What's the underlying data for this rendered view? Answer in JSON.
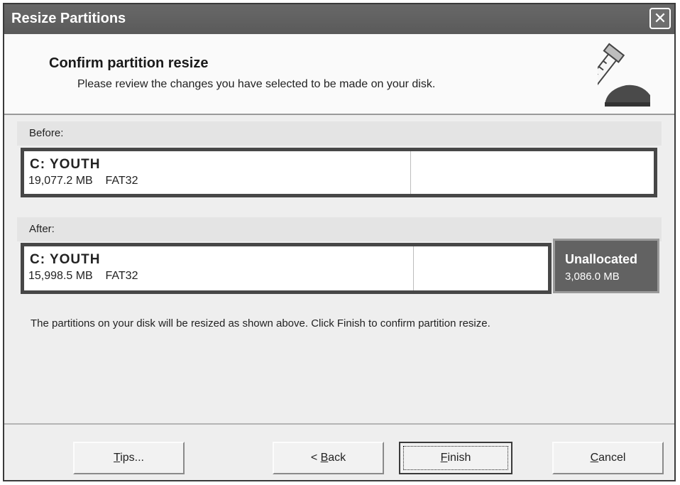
{
  "window": {
    "title": "Resize Partitions",
    "close_glyph": "✕"
  },
  "header": {
    "title": "Confirm partition resize",
    "subtitle": "Please review the changes you have selected to be made on your disk.",
    "icon": "ruler-disk-icon"
  },
  "before": {
    "label": "Before:",
    "partition": {
      "name": "C:  YOUTH",
      "size": "19,077.2 MB",
      "fs": "FAT32"
    }
  },
  "after": {
    "label": "After:",
    "partition": {
      "name": "C:  YOUTH",
      "size": "15,998.5 MB",
      "fs": "FAT32"
    },
    "unallocated": {
      "name": "Unallocated",
      "size": "3,086.0 MB"
    }
  },
  "message": "The partitions on your disk will be resized as shown above.  Click Finish to confirm partition resize.",
  "buttons": {
    "tips": {
      "key": "T",
      "rest": "ips..."
    },
    "back": {
      "prefix": "< ",
      "key": "B",
      "rest": "ack"
    },
    "finish": {
      "key": "F",
      "rest": "inish"
    },
    "cancel": {
      "key": "C",
      "rest": "ancel"
    }
  },
  "colors": {
    "titlebar": "#5e5e5e",
    "partition_border": "#474747",
    "unallocated": "#626262"
  }
}
